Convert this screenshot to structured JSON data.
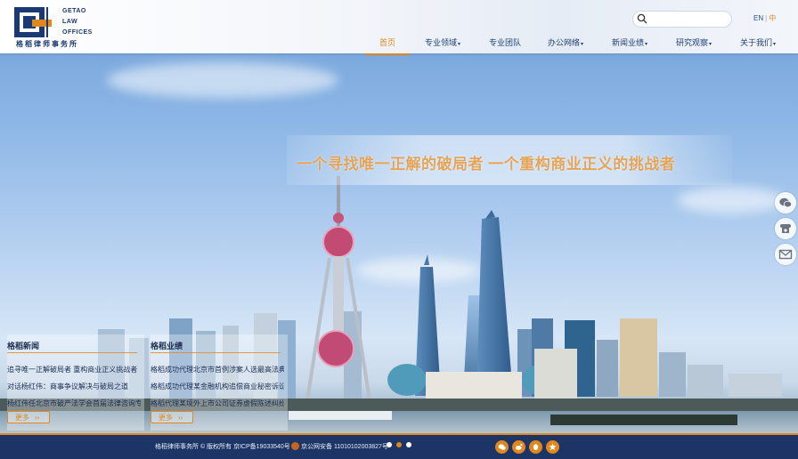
{
  "header": {
    "logo": {
      "line1": "GETAO",
      "line2": "LAW",
      "line3": "OFFICES",
      "cn": "格稻律师事务所"
    },
    "search": {
      "placeholder": ""
    },
    "lang": {
      "en": "EN",
      "sep": "|",
      "zh": "中"
    },
    "nav": [
      {
        "label": "首页",
        "dropdown": false,
        "active": true
      },
      {
        "label": "专业领域",
        "dropdown": true,
        "active": false
      },
      {
        "label": "专业团队",
        "dropdown": false,
        "active": false
      },
      {
        "label": "办公网络",
        "dropdown": true,
        "active": false
      },
      {
        "label": "新闻业绩",
        "dropdown": true,
        "active": false
      },
      {
        "label": "研究观察",
        "dropdown": true,
        "active": false
      },
      {
        "label": "关于我们",
        "dropdown": true,
        "active": false
      }
    ]
  },
  "hero": {
    "slogan": "一个寻找唯一正解的破局者 一个重构商业正义的挑战者"
  },
  "panels": {
    "news": {
      "title": "格稻新闻",
      "items": [
        "追寻唯一正解破局者 重构商业正义挑战者",
        "对话杨红伟：商事争议解决与破局之道",
        "杨红伟任北京市破产法学会首届法律咨询专家"
      ],
      "more": "更多"
    },
    "cases": {
      "title": "格稻业绩",
      "items": [
        "格稻成功代理北京市首例涉案人选最高法典型案例",
        "格稻成功代理某金融机构追偿商业秘密诉讼案",
        "格稻代理某境外上市公司证券虚假陈述纠纷"
      ],
      "more": "更多"
    }
  },
  "side_icons": [
    "wechat-icon",
    "phone-icon",
    "mail-icon"
  ],
  "carousel": {
    "slides": 3,
    "current": 2
  },
  "footer": {
    "copyright": "格稻律师事务所 © 版权所有 京ICP备19033540号",
    "police": "京公网安备 11010102003827号",
    "icons": [
      "wechat-icon",
      "weibo-icon",
      "qq-icon",
      "star-icon"
    ]
  },
  "colors": {
    "accent": "#e0871e",
    "navy": "#1c3566",
    "nav_text": "#1f3f77"
  }
}
